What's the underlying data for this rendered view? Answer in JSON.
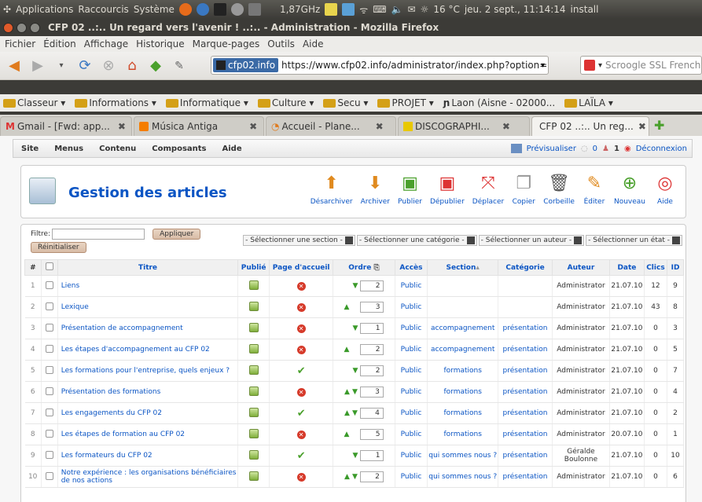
{
  "panel": {
    "applications": "Applications",
    "shortcuts": "Raccourcis",
    "system": "Système",
    "cpu": "1,87GHz",
    "weather": "16 °C",
    "datetime": "jeu. 2 sept., 11:14:14",
    "install": "install"
  },
  "window": {
    "title": "CFP 02 ..:.. Un regard vers l'avenir ! ..:.. - Administration - Mozilla Firefox"
  },
  "menus": [
    "Fichier",
    "Édition",
    "Affichage",
    "Historique",
    "Marque-pages",
    "Outils",
    "Aide"
  ],
  "nav": {
    "site_id": "cfp02.info",
    "url": "https://www.cfp02.info/administrator/index.php?option=com",
    "search": "Scroogle SSL French"
  },
  "bookmarks": [
    "Classeur ▾",
    "Informations ▾",
    "Informatique ▾",
    "Culture ▾",
    "Secu ▾",
    "PROJET ▾",
    "Laon (Aisne - 02000...",
    "LAÏLA ▾"
  ],
  "tabs": [
    {
      "label": "Gmail - [Fwd: app...",
      "close": "✖"
    },
    {
      "label": "Música Antiga",
      "close": "✖"
    },
    {
      "label": "Accueil - Plane...",
      "close": "✖"
    },
    {
      "label": "DISCOGRAPHI...",
      "close": "✖"
    },
    {
      "label": "CFP 02 ..:.. Un reg...",
      "close": "✖"
    }
  ],
  "admin": {
    "menu": [
      "Site",
      "Menus",
      "Contenu",
      "Composants",
      "Aide"
    ],
    "preview": "Prévisualiser",
    "msgs": "0",
    "users": "1",
    "logout": "Déconnexion"
  },
  "page": {
    "title": "Gestion des articles"
  },
  "toolbar": [
    "Désarchiver",
    "Archiver",
    "Publier",
    "Dépublier",
    "Déplacer",
    "Copier",
    "Corbeille",
    "Éditer",
    "Nouveau",
    "Aide"
  ],
  "filter": {
    "label": "Filtre:",
    "apply": "Appliquer",
    "reset": "Réinitialiser",
    "sel_section": "- Sélectionner une section -",
    "sel_category": "- Sélectionner une catégorie -",
    "sel_author": "- Sélectionner un auteur -",
    "sel_state": "- Sélectionner un état -"
  },
  "columns": [
    "#",
    "",
    "Titre",
    "Publié",
    "Page d'accueil",
    "Ordre",
    "Accès",
    "Section",
    "Catégorie",
    "Auteur",
    "Date",
    "Clics",
    "ID"
  ],
  "rows": [
    {
      "n": "1",
      "title": "Liens",
      "front": "x",
      "up": false,
      "down": true,
      "order": "2",
      "access": "Public",
      "section": "",
      "category": "",
      "author": "Administrator",
      "date": "21.07.10",
      "hits": "12",
      "id": "9"
    },
    {
      "n": "2",
      "title": "Lexique",
      "front": "x",
      "up": true,
      "down": false,
      "order": "3",
      "access": "Public",
      "section": "",
      "category": "",
      "author": "Administrator",
      "date": "21.07.10",
      "hits": "43",
      "id": "8"
    },
    {
      "n": "3",
      "title": "Présentation de accompagnement",
      "front": "x",
      "up": false,
      "down": true,
      "order": "1",
      "access": "Public",
      "section": "accompagnement",
      "category": "présentation",
      "author": "Administrator",
      "date": "21.07.10",
      "hits": "0",
      "id": "3"
    },
    {
      "n": "4",
      "title": "Les étapes d'accompagnement au CFP 02",
      "front": "x",
      "up": true,
      "down": false,
      "order": "2",
      "access": "Public",
      "section": "accompagnement",
      "category": "présentation",
      "author": "Administrator",
      "date": "21.07.10",
      "hits": "0",
      "id": "5"
    },
    {
      "n": "5",
      "title": "Les formations pour l'entreprise, quels enjeux ?",
      "front": "check",
      "up": false,
      "down": true,
      "order": "2",
      "access": "Public",
      "section": "formations",
      "category": "présentation",
      "author": "Administrator",
      "date": "21.07.10",
      "hits": "0",
      "id": "7"
    },
    {
      "n": "6",
      "title": "Présentation des formations",
      "front": "x",
      "up": true,
      "down": true,
      "order": "3",
      "access": "Public",
      "section": "formations",
      "category": "présentation",
      "author": "Administrator",
      "date": "21.07.10",
      "hits": "0",
      "id": "4"
    },
    {
      "n": "7",
      "title": "Les engagements du CFP 02",
      "front": "check",
      "up": true,
      "down": true,
      "order": "4",
      "access": "Public",
      "section": "formations",
      "category": "présentation",
      "author": "Administrator",
      "date": "21.07.10",
      "hits": "0",
      "id": "2"
    },
    {
      "n": "8",
      "title": "Les étapes de formation au CFP 02",
      "front": "x",
      "up": true,
      "down": false,
      "order": "5",
      "access": "Public",
      "section": "formations",
      "category": "présentation",
      "author": "Administrator",
      "date": "20.07.10",
      "hits": "0",
      "id": "1"
    },
    {
      "n": "9",
      "title": "Les formateurs du CFP 02",
      "front": "check",
      "up": false,
      "down": true,
      "order": "1",
      "access": "Public",
      "section": "qui sommes nous ?",
      "category": "présentation",
      "author": "Géralde Boulonne",
      "date": "21.07.10",
      "hits": "0",
      "id": "10"
    },
    {
      "n": "10",
      "title": "Notre expérience : les organisations bénéficiaires de nos actions",
      "front": "x",
      "up": true,
      "down": true,
      "order": "2",
      "access": "Public",
      "section": "qui sommes nous ?",
      "category": "présentation",
      "author": "Administrator",
      "date": "21.07.10",
      "hits": "0",
      "id": "6"
    }
  ]
}
